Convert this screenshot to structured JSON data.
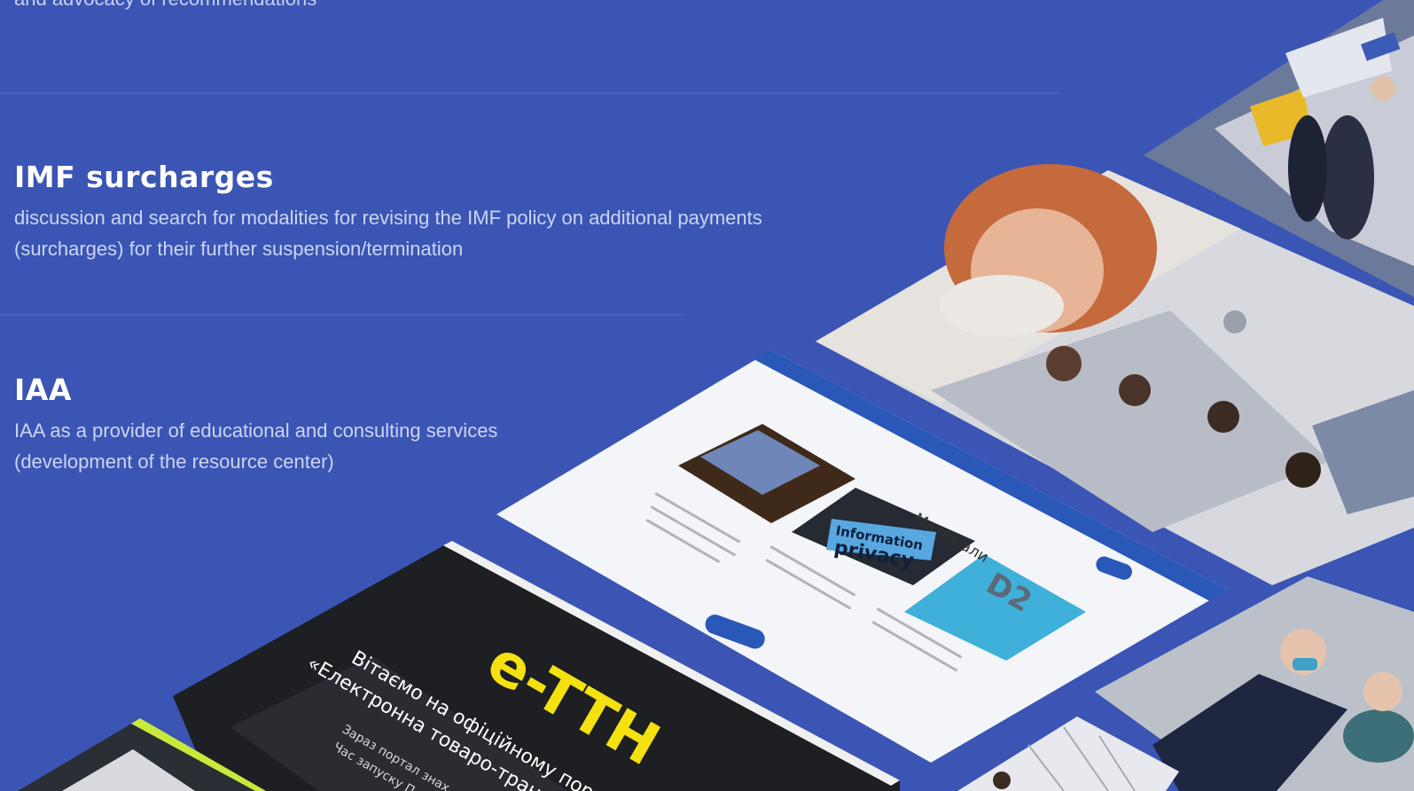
{
  "top_text": "and advocacy of recommendations",
  "sections": [
    {
      "title": "IMF surcharges",
      "description": "discussion and search for modalities for revising the IMF policy on additional payments (surcharges) for their further suspension/termination"
    },
    {
      "title": "IAA",
      "description": "IAA as a provider of educational and consulting services (development of the resource center)"
    }
  ],
  "collage": {
    "materials_heading": "Матеріали",
    "info_privacy_line1": "Information",
    "info_privacy_line2": "privacy",
    "ettn_logo": "e-TTH",
    "ettn_headline_1": "Вітаємо на офіційному порт",
    "ettn_headline_2": "«Електронна товаро-трансп",
    "ettn_sub_1": "Зараз портал знах",
    "ettn_sub_2": "Час запуску П"
  },
  "colors": {
    "background": "#3a55b4",
    "title": "#ffffff",
    "body_text": "#cbd5f3",
    "accent_yellow": "#f5e10f"
  }
}
